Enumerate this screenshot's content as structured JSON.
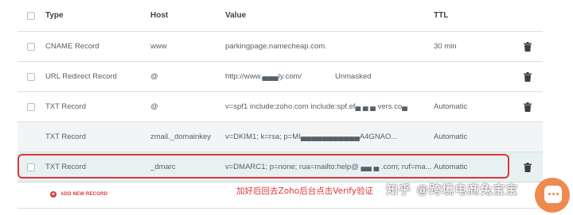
{
  "table": {
    "headers": {
      "type": "Type",
      "host": "Host",
      "value": "Value",
      "ttl": "TTL"
    },
    "rows": [
      {
        "type": "CNAME Record",
        "host": "www",
        "value": "parkingpage.namecheap.com.",
        "extra": "",
        "ttl": "30 min"
      },
      {
        "type": "URL Redirect Record",
        "host": "@",
        "value": "http://www.▄▄▄ly.com/",
        "extra": "Unmasked",
        "ttl": ""
      },
      {
        "type": "TXT Record",
        "host": "@",
        "value": "v=spf1 include:zoho.com include:spf.ef▄  ▄  ▄ vers.co▄",
        "extra": "",
        "ttl": "Automatic"
      },
      {
        "type": "TXT Record",
        "host": "zmail._domainkey",
        "value": "v=DKIM1; k=rsa; p=MI▄▄▄▄▄▄▄▄▄▄▄A4GNAO...",
        "extra": "",
        "ttl": "Automatic"
      },
      {
        "type": "TXT Record",
        "host": "_dmarc",
        "value": "v=DMARC1; p=none; rua=mailto:help@ ▄▄ ▄ .com; ruf=ma...",
        "extra": "",
        "ttl": "Automatic"
      }
    ]
  },
  "actions": {
    "add_new_record": "ADD NEW RECORD",
    "add_icon": "+"
  },
  "annotation": "加好后回去Zoho后台点击Verify验证",
  "watermark": "知乎 @跨境电商兔宝宝",
  "colors": {
    "accent_red": "#d9363b",
    "chat_orange": "#ee8a4e",
    "highlight_row": "#e8f1f1"
  },
  "icons": {
    "delete": "trash-icon",
    "chat": "chat-bubble-icon",
    "add": "plus-circle-icon"
  }
}
